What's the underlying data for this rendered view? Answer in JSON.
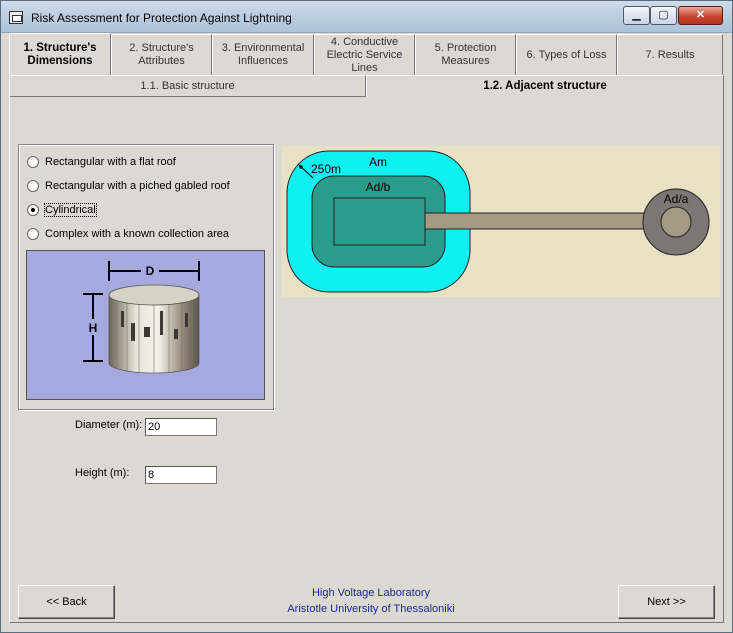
{
  "window": {
    "title": "Risk Assessment for Protection Against Lightning",
    "controls": {
      "minimize": "▁",
      "maximize": "▢",
      "close": "✕"
    }
  },
  "tabs": [
    {
      "line1": "1. Structure's",
      "line2": "Dimensions",
      "line3": ""
    },
    {
      "line1": "2. Structure's",
      "line2": "Attributes",
      "line3": ""
    },
    {
      "line1": "3. Environmental",
      "line2": "Influences",
      "line3": ""
    },
    {
      "line1": "4. Conductive",
      "line2": "Electric Service",
      "line3": "Lines"
    },
    {
      "line1": "5. Protection",
      "line2": "Measures",
      "line3": ""
    },
    {
      "line1": "6. Types of Loss",
      "line2": "",
      "line3": ""
    },
    {
      "line1": "7. Results",
      "line2": "",
      "line3": ""
    }
  ],
  "subtabs": [
    {
      "label": "1.1. Basic structure"
    },
    {
      "label": "1.2. Adjacent structure"
    }
  ],
  "shape_options": [
    {
      "label": "Rectangular with a flat roof",
      "checked": false
    },
    {
      "label": "Rectangular with a piched gabled roof",
      "checked": false
    },
    {
      "label": "Cylindrical",
      "checked": true
    },
    {
      "label": "Complex with a known collection area",
      "checked": false
    }
  ],
  "preview": {
    "diameter_label": "D",
    "height_label": "H"
  },
  "fields": {
    "diameter": {
      "label": "Diameter (m):",
      "value": "20"
    },
    "height": {
      "label": "Height (m):",
      "value": "8"
    }
  },
  "diagram": {
    "area_m": "Am",
    "area_db": "Ad/b",
    "radius": "250m",
    "area_da": "Ad/a",
    "colors": {
      "am_fill": "#0ff0f0",
      "db_fill": "#2a9c8c",
      "da_fill": "#7e7676",
      "background": "#e8e1c4"
    }
  },
  "footer": {
    "line1": "High Voltage Laboratory",
    "line2": "Aristotle University of Thessaloniki"
  },
  "buttons": {
    "back": "<< Back",
    "next": "Next >>"
  }
}
